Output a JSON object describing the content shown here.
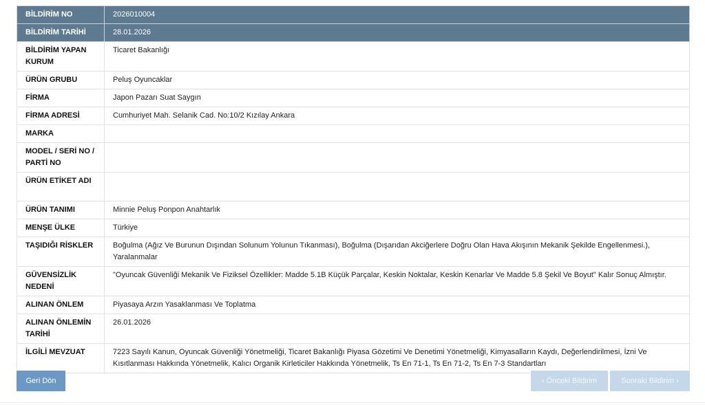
{
  "rows": [
    {
      "label": "BİLDİRİM NO",
      "value": "2026010004"
    },
    {
      "label": "BİLDİRİM TARİHİ",
      "value": "28.01.2026"
    },
    {
      "label": "BİLDİRİM YAPAN KURUM",
      "value": "Ticaret Bakanlığı"
    },
    {
      "label": "ÜRÜN GRUBU",
      "value": "Peluş Oyuncaklar"
    },
    {
      "label": "FİRMA",
      "value": "Japon Pazarı Suat Saygın"
    },
    {
      "label": "FİRMA ADRESİ",
      "value": "Cumhuriyet Mah. Selanik Cad. No:10/2 Kızılay Ankara"
    },
    {
      "label": "MARKA",
      "value": ""
    },
    {
      "label": "MODEL / SERİ NO / PARTİ NO",
      "value": ""
    },
    {
      "label": "ÜRÜN ETİKET ADI",
      "value": ""
    },
    {
      "label": "ÜRÜN TANIMI",
      "value": "Minnie Peluş Ponpon Anahtarlık"
    },
    {
      "label": "MENŞE ÜLKE",
      "value": "Türkiye"
    },
    {
      "label": "TAŞIDIĞI RİSKLER",
      "value": "Boğulma (Ağız Ve Burunun Dışından Solunum Yolunun Tıkanması), Boğulma (Dışarıdan Akciğerlere Doğru Olan Hava Akışının Mekanik Şekilde Engellenmesi.), Yaralanmalar"
    },
    {
      "label": "GÜVENSİZLİK NEDENİ",
      "value": "\"Oyuncak Güvenliği Mekanik Ve Fiziksel Özellikler: Madde 5.1B Küçük Parçalar, Keskin Noktalar, Keskin Kenarlar Ve Madde 5.8 Şekil Ve Boyut\" Kalır Sonuç Almıştır."
    },
    {
      "label": "ALINAN ÖNLEM",
      "value": "Piyasaya Arzın Yasaklanması Ve Toplatma"
    },
    {
      "label": "ALINAN ÖNLEMİN TARİHİ",
      "value": "26.01.2026"
    },
    {
      "label": "İLGİLİ MEVZUAT",
      "value": "7223 Sayılı Kanun, Oyuncak Güvenliği Yönetmeliği, Ticaret Bakanlığı Piyasa Gözetimi Ve Denetimi Yönetmeliği, Kimyasalların Kaydı, Değerlendirilmesi, İzni Ve Kısıtlanması Hakkında Yönetmelik, Kalıcı Organik Kirleticiler Hakkında Yönetmelik, Ts En 71-1, Ts En 71-2, Ts En 7-3 Standartları"
    }
  ],
  "buttons": {
    "back": "Geri Dön",
    "prev": "Önceki Bildirim",
    "next": "Sonraki Bildirim",
    "prev_icon": "‹",
    "next_icon": "›"
  },
  "colors": {
    "header_bg": "#5d7a90",
    "back_button": "#6c98c6",
    "disabled_button": "#c5d8ea"
  },
  "icons": {
    "prev": "chevron-left-icon",
    "next": "chevron-right-icon"
  }
}
